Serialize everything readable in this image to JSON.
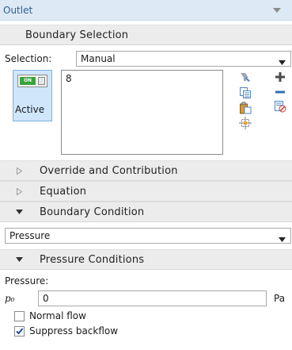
{
  "panel": {
    "title": "Outlet"
  },
  "boundary_selection": {
    "header": "Boundary Selection",
    "selection_label": "Selection:",
    "selection_value": "Manual",
    "active_toggle": {
      "state_text": "ON",
      "caption": "Active"
    },
    "selected_boundaries": [
      "8"
    ]
  },
  "sections": {
    "override": "Override and Contribution",
    "equation": "Equation",
    "boundary_condition": "Boundary Condition",
    "pressure_conditions": "Pressure Conditions"
  },
  "boundary_condition": {
    "value": "Pressure"
  },
  "pressure_conditions": {
    "pressure_label": "Pressure:",
    "symbol": "p₀",
    "value": "0",
    "unit": "Pa",
    "normal_flow": {
      "label": "Normal flow",
      "checked": false
    },
    "suppress_backflow": {
      "label": "Suppress backflow",
      "checked": true
    }
  },
  "colors": {
    "title_bg": "#dde9f5",
    "title_text": "#2f5f93",
    "section_bg": "#ececec",
    "toggle_bg": "#cfe6fb",
    "on_green": "#3aa33a"
  },
  "icons": [
    "collapse-panel-icon",
    "paste-selection-icon",
    "copy-selection-icon",
    "paste-icon",
    "zoom-selection-icon",
    "add-icon",
    "remove-icon",
    "clear-selection-icon"
  ]
}
